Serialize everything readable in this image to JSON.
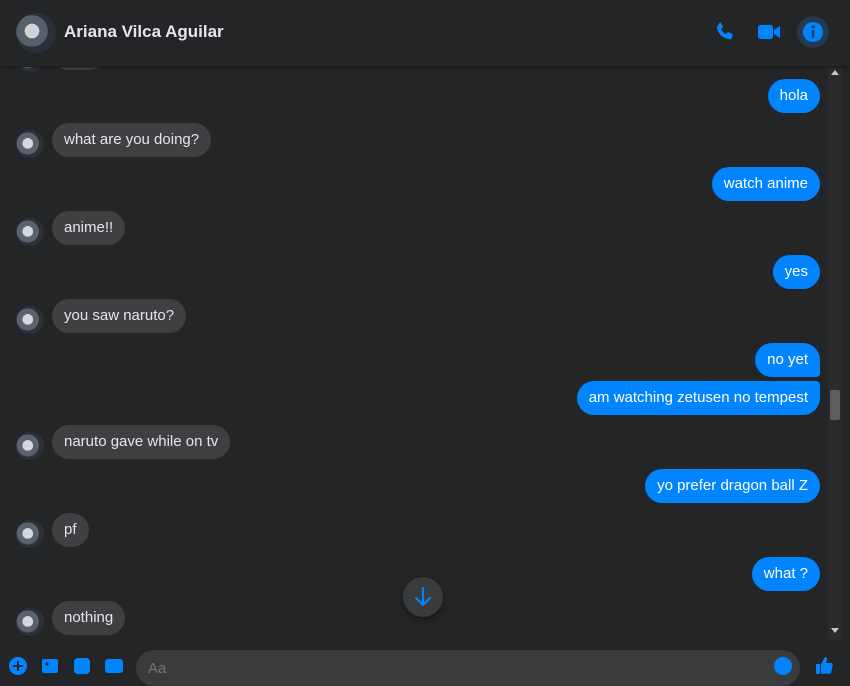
{
  "header": {
    "contact_name": "Ariana Vilca Aguilar",
    "icons": [
      "phone-icon",
      "video-camera-icon",
      "info-icon"
    ]
  },
  "colors": {
    "background": "#242526",
    "outgoing_bubble": "#0084ff",
    "incoming_bubble": "#3e4042",
    "accent": "#0084ff"
  },
  "messages": [
    {
      "direction": "in",
      "text": ""
    },
    {
      "direction": "out",
      "text": "hola"
    },
    {
      "direction": "in",
      "text": "what are you doing?"
    },
    {
      "direction": "out",
      "text": "watch anime"
    },
    {
      "direction": "in",
      "text": "anime!!"
    },
    {
      "direction": "out",
      "text": "yes"
    },
    {
      "direction": "in",
      "text": "you saw naruto?"
    },
    {
      "direction": "out",
      "text": "no yet"
    },
    {
      "direction": "out",
      "text": "am watching zetusen no tempest"
    },
    {
      "direction": "in",
      "text": "naruto gave while on tv"
    },
    {
      "direction": "out",
      "text": "yo prefer dragon ball Z"
    },
    {
      "direction": "in",
      "text": "pf"
    },
    {
      "direction": "out",
      "text": "what ?"
    },
    {
      "direction": "in",
      "text": "nothing"
    }
  ],
  "composer": {
    "placeholder": "Aa",
    "icons": [
      "plus-icon",
      "image-icon",
      "sticker-icon",
      "gif-icon",
      "emoji-icon",
      "like-icon"
    ]
  },
  "scroll_down_icon": "arrow-down-icon"
}
